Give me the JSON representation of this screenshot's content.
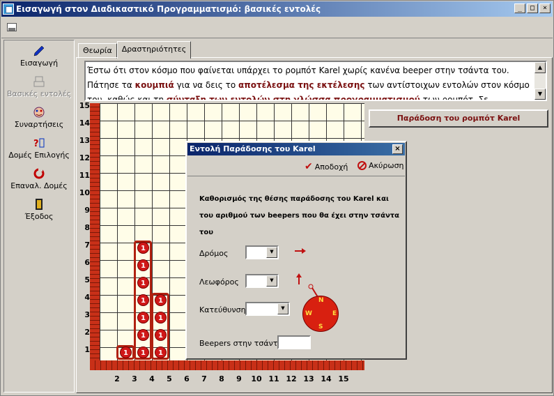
{
  "window": {
    "title": "Εισαγωγή στον Διαδικαστικό Προγραμματισμό: βασικές εντολές",
    "min_label": "_",
    "max_label": "□",
    "close_label": "×"
  },
  "sidebar": {
    "items": [
      {
        "label": "Εισαγωγή",
        "icon": "pencil-icon",
        "enabled": true
      },
      {
        "label": "Βασικές εντολές",
        "icon": "robot-icon",
        "enabled": false
      },
      {
        "label": "Συναρτήσεις",
        "icon": "face-icon",
        "enabled": true
      },
      {
        "label": "Δομές Επιλογής",
        "icon": "question-icon",
        "enabled": true
      },
      {
        "label": "Επαναλ. Δομές",
        "icon": "loop-icon",
        "enabled": true
      },
      {
        "label": "Έξοδος",
        "icon": "exit-door-icon",
        "enabled": true
      }
    ]
  },
  "tabs": [
    {
      "label": "Θεωρία",
      "active": false
    },
    {
      "label": "Δραστηριότητες",
      "active": true
    }
  ],
  "theory": {
    "p1": "Έστω ότι στον κόσμο που φαίνεται υπάρχει το ρομπότ Karel χωρίς κανένα beeper στην τσάντα του. Πάτησε τα ",
    "b1": "κουμπιά",
    "p2": " για να δεις το ",
    "b2": "αποτέλεσμα της εκτέλεσης",
    "p3": " των αντίστοιχων εντολών στον κόσμο του, καθώς και τη ",
    "b3": "σύνταξη των εντολών στη γλώσσα προγραμματισμού",
    "p4": " των ρομπότ. Σε περίπτωση που ο Karel εκτελέσει μια"
  },
  "deliver_button": "Παράδοση του ρομπότ Karel",
  "world": {
    "streets": 15,
    "avenues": 15,
    "row_labels": [
      "15",
      "14",
      "13",
      "12",
      "11",
      "10",
      "9",
      "8",
      "7",
      "6",
      "5",
      "4",
      "3",
      "2",
      "1"
    ],
    "col_labels": [
      "2",
      "3",
      "4",
      "5",
      "6",
      "7",
      "8",
      "9",
      "10",
      "11",
      "12",
      "13",
      "14",
      "15"
    ],
    "beeper_label": "1",
    "stacks": [
      {
        "avenue": 2,
        "from": 1,
        "to": 1
      },
      {
        "avenue": 3,
        "from": 1,
        "to": 7
      },
      {
        "avenue": 4,
        "from": 1,
        "to": 4
      }
    ]
  },
  "dialog": {
    "title": "Εντολή Παράδοσης του Karel",
    "close_label": "×",
    "accept": "Αποδοχή",
    "cancel": "Ακύρωση",
    "description": "Καθορισμός της θέσης παράδοσης του Karel και του αριθμού των beepers που θα έχει στην τσάντα του",
    "street_label": "Δρόμος",
    "avenue_label": "Λεωφόρος",
    "direction_label": "Κατεύθυνση",
    "beepers_label": "Beepers στην τσάντα",
    "compass": {
      "n": "N",
      "s": "S",
      "e": "E",
      "w": "W"
    }
  },
  "colors": {
    "accent": "#7a1010",
    "wall": "#c83018",
    "beeper": "#d01818"
  }
}
